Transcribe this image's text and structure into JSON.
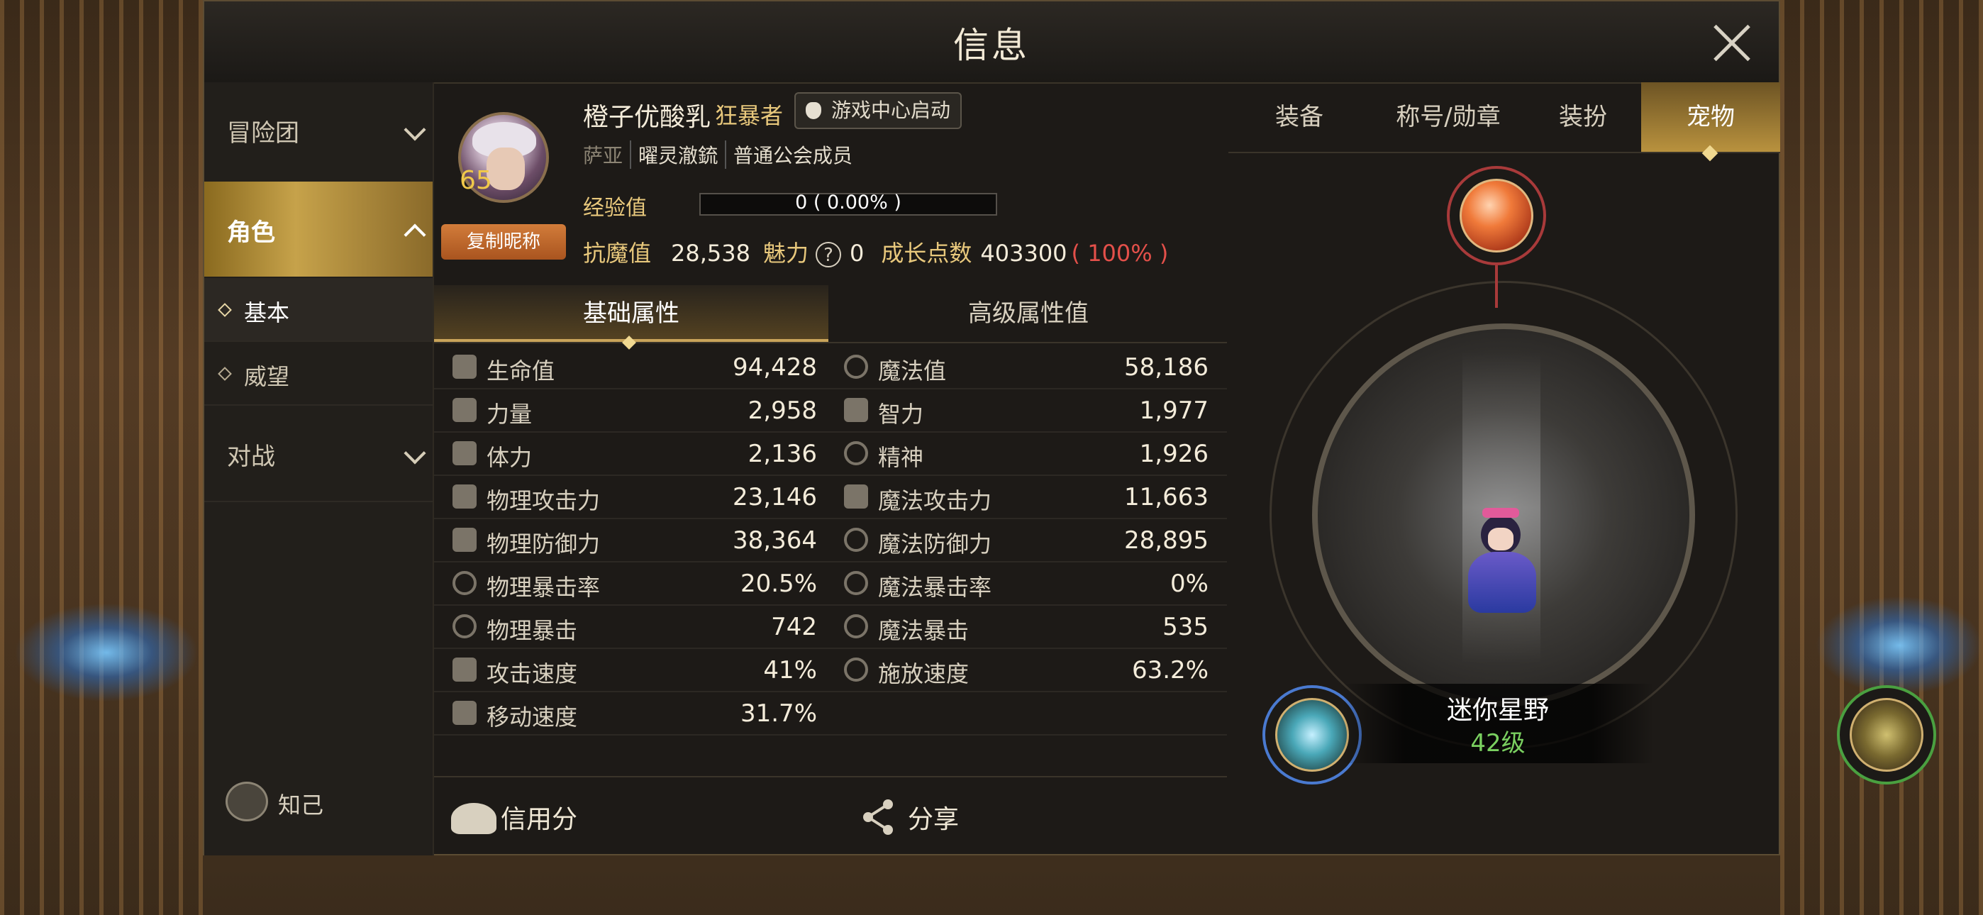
{
  "window": {
    "title": "信息"
  },
  "sidebar": {
    "groups": [
      {
        "label": "冒险团"
      },
      {
        "label": "角色"
      },
      {
        "label": "对战"
      }
    ],
    "sub_items": [
      {
        "label": "基本"
      },
      {
        "label": "威望"
      }
    ],
    "self_label": "知己"
  },
  "profile": {
    "name": "橙子优酸乳",
    "class": "狂暴者",
    "game_center_label": "游戏中心启动",
    "level": "65",
    "copy_label": "复制昵称",
    "tags": [
      "萨亚",
      "曜灵澈鋶",
      "普通公会成员"
    ],
    "exp_label": "经验值",
    "exp_text": "0 ( 0.00% )",
    "resist_label": "抗魔值",
    "resist_value": "28,538",
    "charm_label": "魅力",
    "charm_value": "0",
    "growth_label": "成长点数",
    "growth_value": "403300",
    "growth_pct": "( 100% )"
  },
  "subtabs": [
    "基础属性",
    "高级属性值"
  ],
  "attributes": [
    {
      "lk": "生命值",
      "lv": "94,428",
      "rk": "魔法值",
      "rv": "58,186"
    },
    {
      "lk": "力量",
      "lv": "2,958",
      "rk": "智力",
      "rv": "1,977"
    },
    {
      "lk": "体力",
      "lv": "2,136",
      "rk": "精神",
      "rv": "1,926"
    },
    {
      "lk": "物理攻击力",
      "lv": "23,146",
      "rk": "魔法攻击力",
      "rv": "11,663"
    },
    {
      "lk": "物理防御力",
      "lv": "38,364",
      "rk": "魔法防御力",
      "rv": "28,895"
    },
    {
      "lk": "物理暴击率",
      "lv": "20.5%",
      "rk": "魔法暴击率",
      "rv": "0%"
    },
    {
      "lk": "物理暴击",
      "lv": "742",
      "rk": "魔法暴击",
      "rv": "535"
    },
    {
      "lk": "攻击速度",
      "lv": "41%",
      "rk": "施放速度",
      "rv": "63.2%"
    },
    {
      "lk": "移动速度",
      "lv": "31.7%",
      "rk": "",
      "rv": ""
    }
  ],
  "bottom": {
    "credit_label": "信用分",
    "share_label": "分享"
  },
  "right_tabs": [
    "装备",
    "称号/勋章",
    "装扮",
    "宠物"
  ],
  "pet": {
    "name": "迷你星野",
    "level": "42级"
  }
}
